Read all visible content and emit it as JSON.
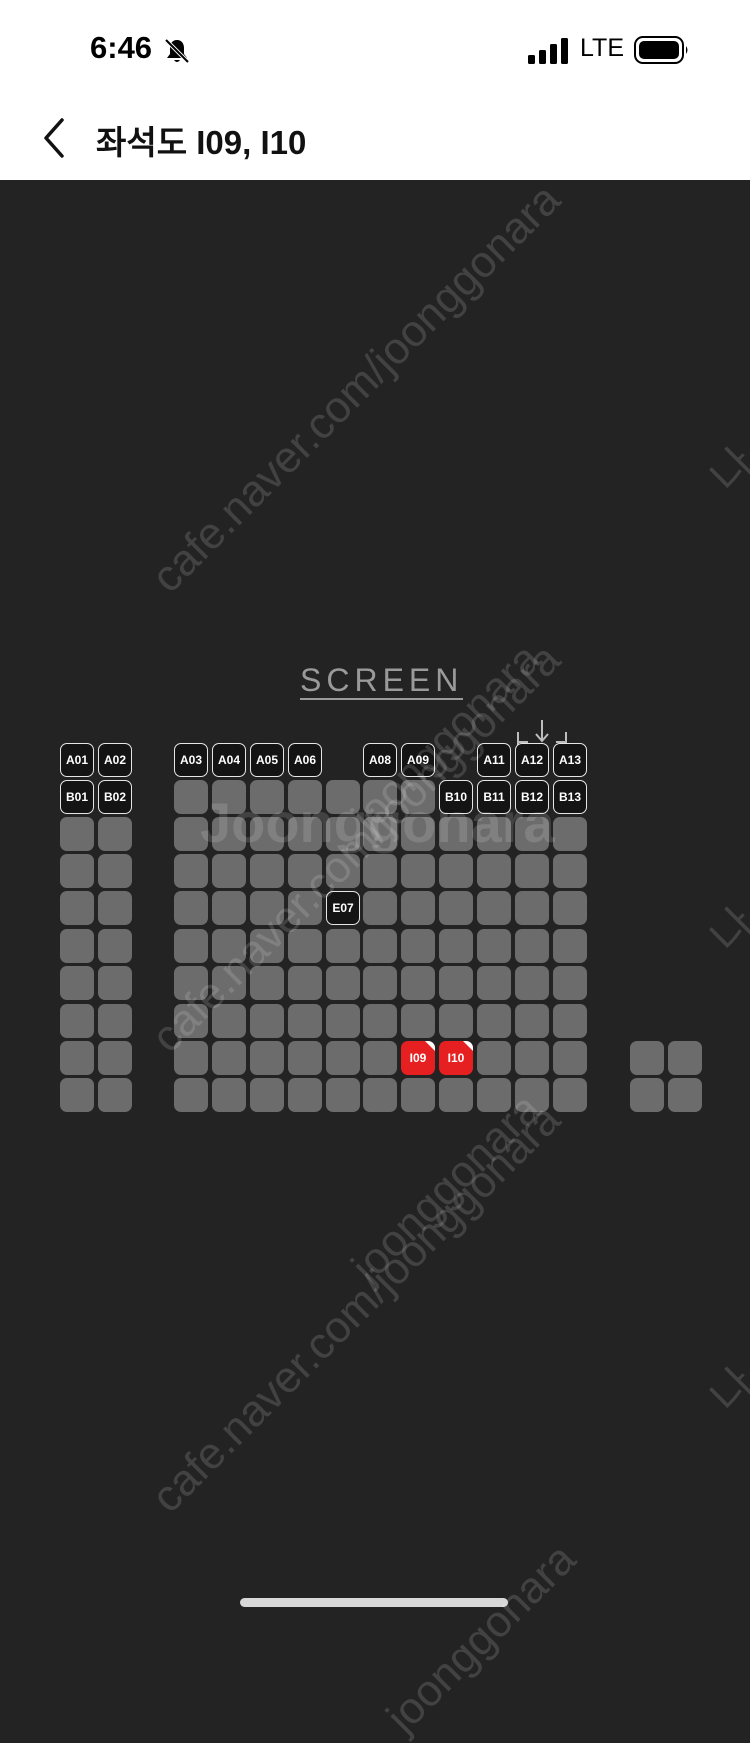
{
  "status_bar": {
    "time": "6:46",
    "network": "LTE"
  },
  "header": {
    "title": "좌석도 I09, I10"
  },
  "map": {
    "screen_label": "SCREEN"
  },
  "colors": {
    "selected": "#e62020",
    "available": "#6c6c6c",
    "labeled_bg": "#141414"
  },
  "watermark": {
    "text": "cafe.naver.com/joonggonara",
    "big_text": "Joonggonara",
    "partial": "joonggonara",
    "edge": "나"
  },
  "seat_labels": {
    "A01": "A01",
    "A02": "A02",
    "A03": "A03",
    "A04": "A04",
    "A05": "A05",
    "A06": "A06",
    "A08": "A08",
    "A09": "A09",
    "A11": "A11",
    "A12": "A12",
    "A13": "A13",
    "B01": "B01",
    "B02": "B02",
    "B10": "B10",
    "B11": "B11",
    "B12": "B12",
    "B13": "B13",
    "E07": "E07",
    "I09": "I09",
    "I10": "I10"
  },
  "selected_seats": [
    "I09",
    "I10"
  ]
}
